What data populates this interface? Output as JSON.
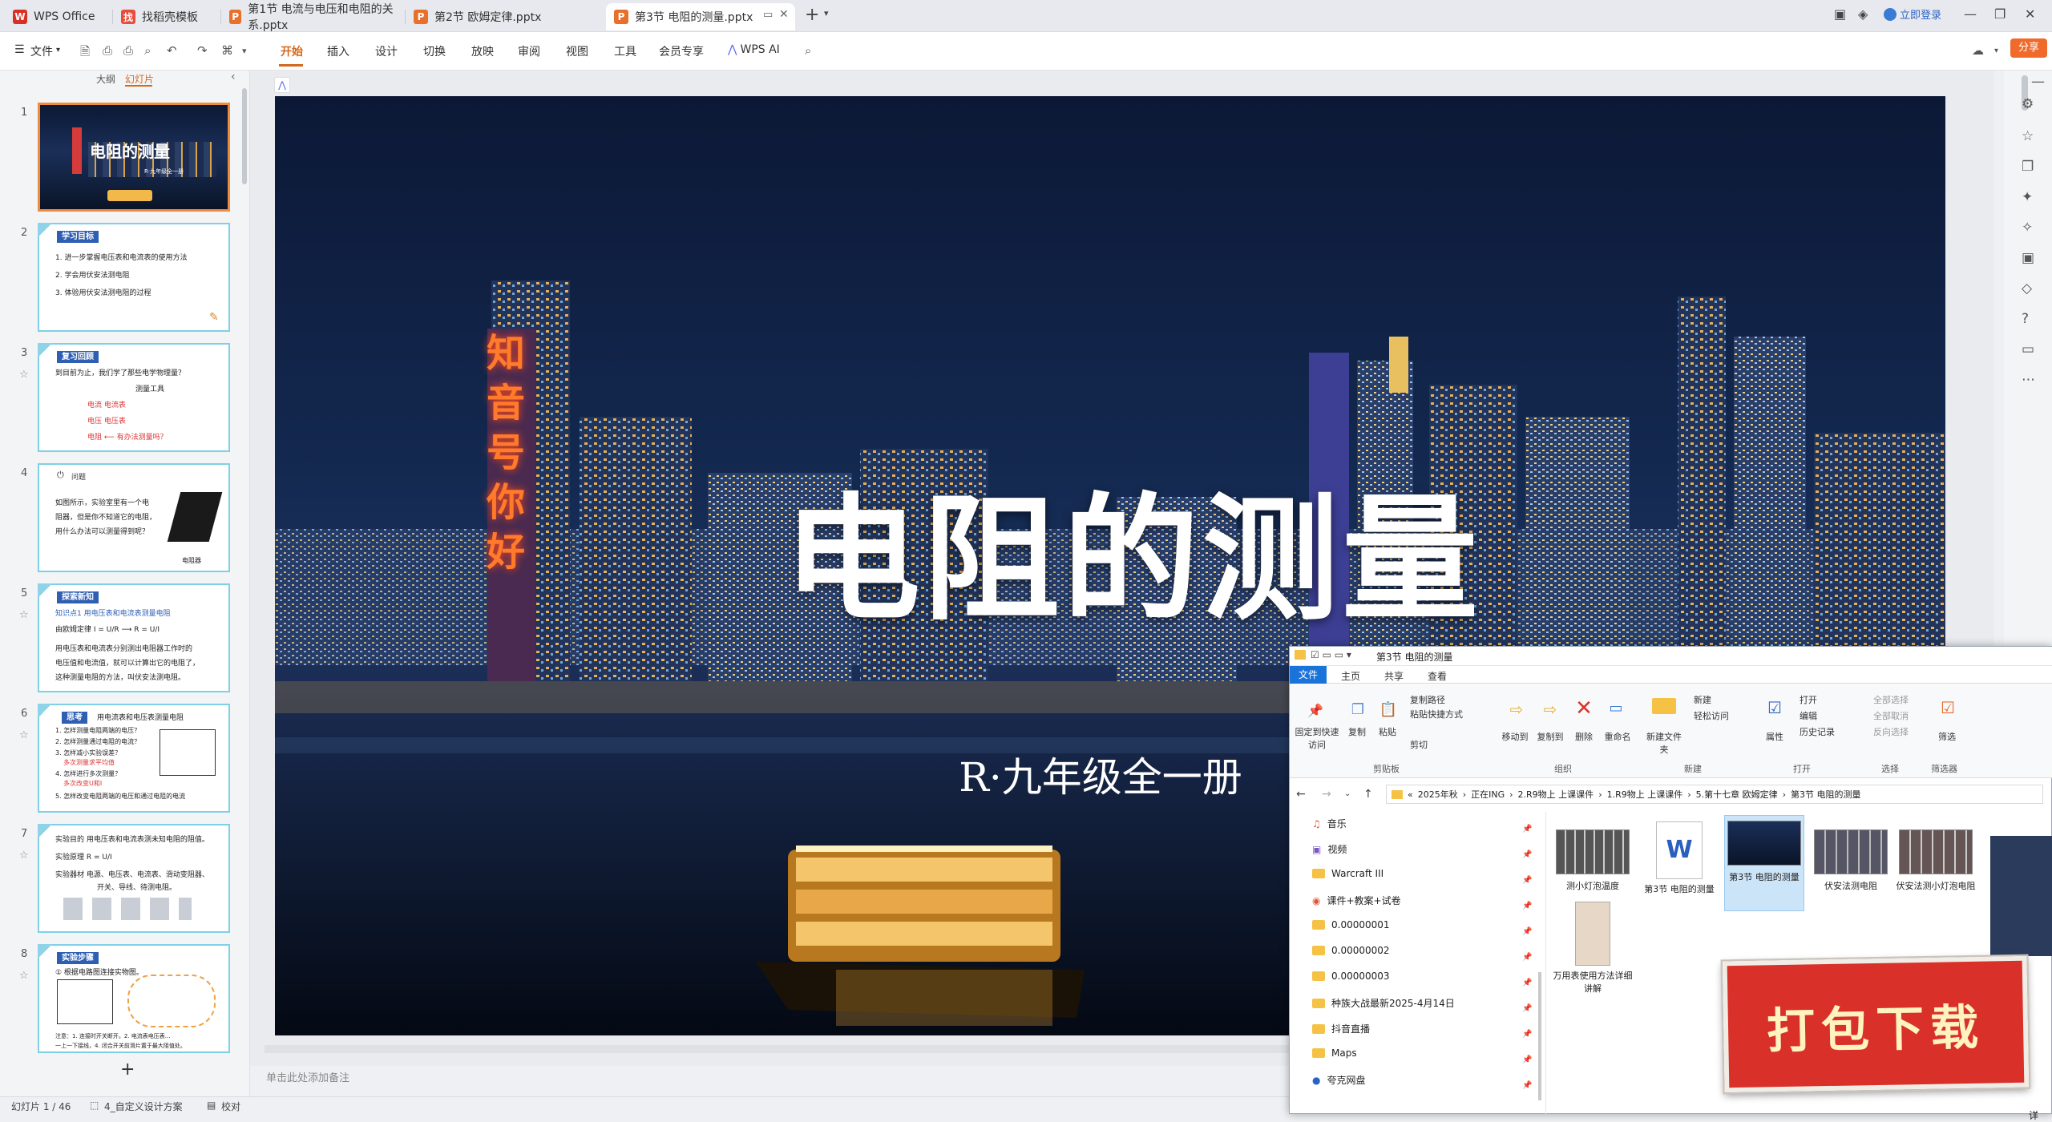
{
  "tabs": [
    {
      "label": "WPS Office",
      "icon": "wps-logo-icon",
      "active": false
    },
    {
      "label": "找稻壳模板",
      "icon": "docer-icon",
      "active": false
    },
    {
      "label": "第1节 电流与电压和电阻的关系.pptx",
      "icon": "pptx-icon",
      "active": false
    },
    {
      "label": "第2节 欧姆定律.pptx",
      "icon": "pptx-icon",
      "active": false
    },
    {
      "label": "第3节 电阻的测量.pptx",
      "icon": "pptx-icon",
      "active": true
    }
  ],
  "titlebar": {
    "login": "立即登录"
  },
  "menubar": {
    "file": "文件",
    "items": [
      "开始",
      "插入",
      "设计",
      "切换",
      "放映",
      "审阅",
      "视图",
      "工具",
      "会员专享",
      "WPS AI"
    ],
    "active": "开始",
    "share": "分享"
  },
  "panel": {
    "outline": "大纲",
    "slides": "幻灯片"
  },
  "thumbnails": [
    {
      "num": "1",
      "title": "电阻的测量",
      "subtitle": "R·九年级全一册"
    },
    {
      "num": "2",
      "banner": "学习目标",
      "lines": [
        "1. 进一步掌握电压表和电流表的使用方法",
        "2. 学会用伏安法测电阻",
        "3. 体验用伏安法测电阻的过程"
      ]
    },
    {
      "num": "3",
      "banner": "复习回顾",
      "lines": [
        "到目前为止，我们学了那些电学物理量？",
        "测量工具",
        "电流      电流表",
        "电压      电压表",
        "电阻  ⟵  有办法测量吗？"
      ]
    },
    {
      "num": "4",
      "banner": "问题",
      "lines": [
        "如图所示，实验室里有一个电",
        "阻器，但是你不知道它的电阻，",
        "用什么办法可以测量得到呢？",
        "电阻器"
      ]
    },
    {
      "num": "5",
      "banner": "探索新知",
      "lines": [
        "知识点1  用电压表和电流表测量电阻",
        "由欧姆定律  I = U/R  ⟶  R = U/I",
        "用电压表和电流表分别测出电阻器工作时的",
        "电压值和电流值，就可以计算出它的电阻了，",
        "这种测量电阻的方法，叫伏安法测电阻。"
      ]
    },
    {
      "num": "6",
      "banner": "思考",
      "lines": [
        "用电流表和电压表测量电阻",
        "1. 怎样测量电阻两端的电压？",
        "2. 怎样测量通过电阻的电流？",
        "3. 怎样减小实验误差？",
        "多次测量求平均值",
        "4. 怎样进行多次测量？",
        "多次改变U和I",
        "5. 怎样改变电阻两端的电压和通过电阻的电流"
      ]
    },
    {
      "num": "7",
      "banner": "实验目的",
      "lines": [
        "实验目的  用电压表和电流表测未知电阻的阻值。",
        "实验原理  R = U/I",
        "实验器材  电源、电压表、电流表、滑动变阻器、",
        "开关、导线、待测电阻。"
      ]
    },
    {
      "num": "8",
      "banner": "实验步骤",
      "lines": [
        "① 根据电路图连接实物图。",
        "注意：1. 连接时开关断开。2. 电流表电压表...",
        "一上一下接线，4. 闭合开关前滑片置于最大阻值处。"
      ]
    }
  ],
  "slide": {
    "title": "电阻的测量",
    "subtitle": "R·九年级全一册",
    "neon_sign": "知音号你好"
  },
  "notes_placeholder": "单击此处添加备注",
  "status": {
    "slide_count": "幻灯片 1 / 46",
    "theme": "4_自定义设计方案",
    "proof": "校对"
  },
  "explorer": {
    "title": "第3节 电阻的测量",
    "ribbon_tabs": [
      "文件",
      "主页",
      "共享",
      "查看"
    ],
    "ribbon_buttons": {
      "pin": "固定到快速访问",
      "copy": "复制",
      "paste": "粘贴",
      "copy_path": "复制路径",
      "paste_shortcut": "粘贴快捷方式",
      "cut": "剪切",
      "move_to": "移动到",
      "copy_to": "复制到",
      "delete": "删除",
      "rename": "重命名",
      "new_folder": "新建文件夹",
      "new_item": "新建",
      "easy_access": "轻松访问",
      "properties": "属性",
      "open": "打开",
      "edit": "编辑",
      "history": "历史记录",
      "select_all": "全部选择",
      "select_none": "全部取消",
      "invert": "反向选择",
      "filter": "筛选"
    },
    "groups": [
      "剪贴板",
      "组织",
      "新建",
      "打开",
      "选择",
      "筛选器"
    ],
    "breadcrumb": [
      "«",
      "2025年秋",
      "正在ING",
      "2.R9物上 上课课件",
      "1.R9物上 上课课件",
      "5.第十七章 欧姆定律",
      "第3节 电阻的测量"
    ],
    "nav": [
      "音乐",
      "视频",
      "Warcraft III",
      "课件+教案+试卷",
      "0.00000001",
      "0.00000002",
      "0.00000003",
      "种族大战最新2025-4月14日",
      "抖音直播",
      "Maps",
      "夸克网盘"
    ],
    "files": [
      {
        "name": "测小灯泡温度",
        "kind": "video"
      },
      {
        "name": "第3节 电阻的测量",
        "kind": "word"
      },
      {
        "name": "第3节 电阻的测量",
        "kind": "pptx"
      },
      {
        "name": "伏安法测电阻",
        "kind": "video"
      },
      {
        "name": "伏安法测小灯泡电阻",
        "kind": "video"
      },
      {
        "name": "万用表使用方法详细讲解",
        "kind": "video"
      }
    ],
    "partial": "详"
  },
  "download_banner": "打包下载"
}
